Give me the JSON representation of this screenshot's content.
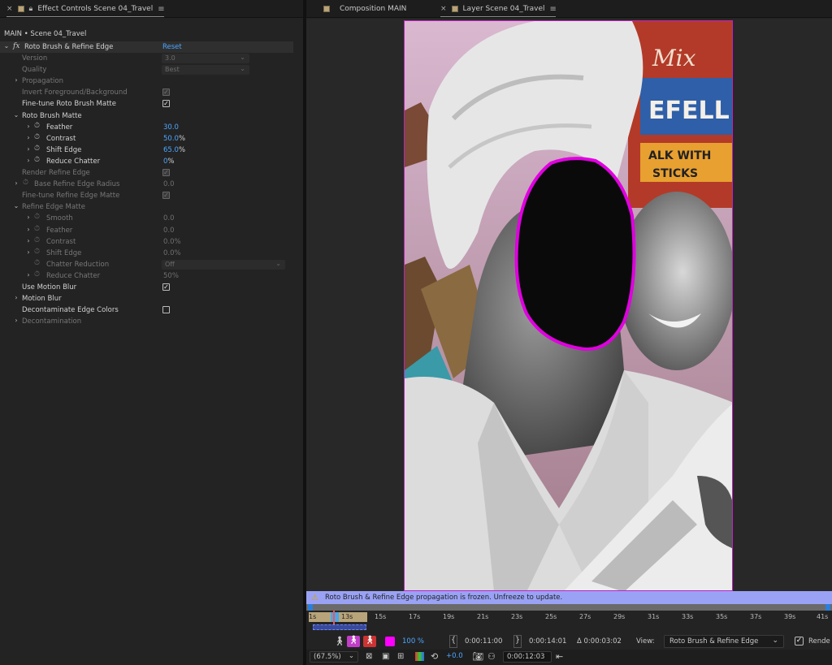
{
  "left_panel": {
    "tab": {
      "close": "×",
      "title": "Effect Controls Scene 04_Travel",
      "menu": "≡"
    },
    "subtitle": "MAIN • Scene 04_Travel",
    "effect": {
      "name": "Roto Brush & Refine Edge",
      "reset_label": "Reset",
      "fx": "fx"
    },
    "props": [
      {
        "label": "Version",
        "value": "3.0"
      },
      {
        "label": "Quality",
        "value": "Best"
      },
      {
        "label": "Propagation"
      },
      {
        "label": "Invert Foreground/Background"
      },
      {
        "label": "Fine-tune Roto Brush Matte"
      },
      {
        "label": "Roto Brush Matte"
      },
      {
        "label": "Feather",
        "value": "30.0"
      },
      {
        "label": "Contrast",
        "value": "50.0",
        "unit": "%"
      },
      {
        "label": "Shift Edge",
        "value": "65.0",
        "unit": "%"
      },
      {
        "label": "Reduce Chatter",
        "value": "0",
        "unit": "%"
      },
      {
        "label": "Render Refine Edge"
      },
      {
        "label": "Base Refine Edge Radius",
        "value": "0.0"
      },
      {
        "label": "Fine-tune Refine Edge Matte"
      },
      {
        "label": "Refine Edge Matte"
      },
      {
        "label": "Smooth",
        "value": "0.0"
      },
      {
        "label": "Feather",
        "value": "0.0"
      },
      {
        "label": "Contrast",
        "value": "0.0%"
      },
      {
        "label": "Shift Edge",
        "value": "0.0%"
      },
      {
        "label": "Chatter Reduction",
        "value": "Off"
      },
      {
        "label": "Reduce Chatter",
        "value": "50%"
      },
      {
        "label": "Use Motion Blur"
      },
      {
        "label": "Motion Blur"
      },
      {
        "label": "Decontaminate Edge Colors"
      },
      {
        "label": "Decontamination"
      }
    ]
  },
  "right_panel": {
    "tabs": [
      {
        "close": "",
        "label": "Composition MAIN",
        "menu": ""
      },
      {
        "close": "×",
        "label": "Layer Scene 04_Travel",
        "menu": "≡"
      }
    ],
    "sign": {
      "line1": "Mix",
      "line2": "EFELL",
      "line3": "ALK WITH",
      "line4": "STICKS"
    },
    "warning": "Roto Brush & Refine Edge propagation is frozen. Unfreeze to update.",
    "timeline": {
      "ticks": [
        "1s",
        "13s",
        "15s",
        "17s",
        "19s",
        "21s",
        "23s",
        "25s",
        "27s",
        "29s",
        "31s",
        "33s",
        "35s",
        "37s",
        "39s",
        "41s"
      ]
    },
    "controls": {
      "opacity": "100 %",
      "in_point": "0:00:11:00",
      "out_point": "0:00:14:01",
      "duration": "Δ 0:00:03:02",
      "view_label": "View:",
      "view_value": "Roto Brush & Refine Edge",
      "render_label": "Rende",
      "zoom": "(67.5%)",
      "exposure": "+0.0",
      "current_time": "0:00:12:03"
    }
  },
  "colors": {
    "accent_blue": "#4da7ff",
    "matte_magenta": "#e000e0",
    "warning_bg": "#9aa2f5"
  }
}
